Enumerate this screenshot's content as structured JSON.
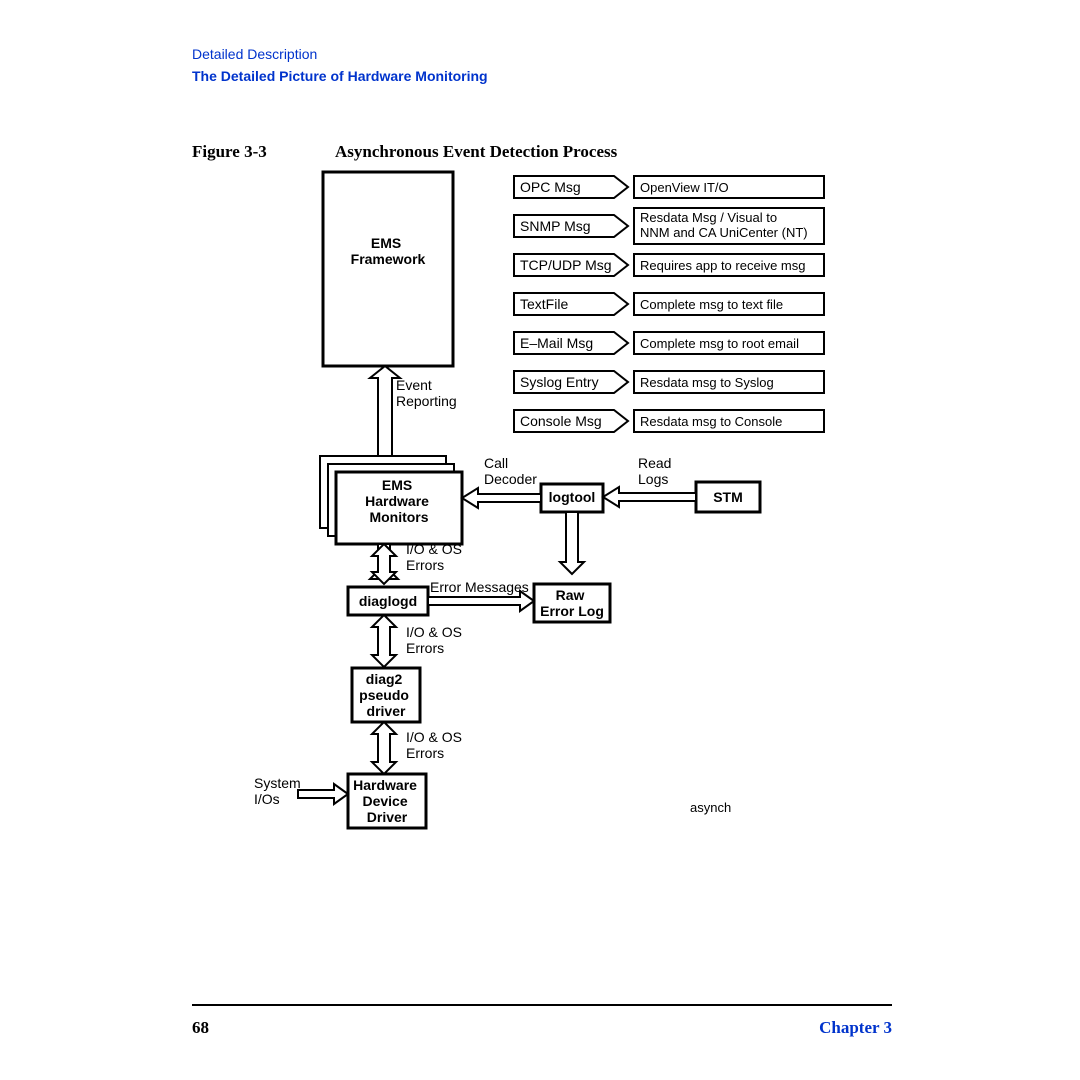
{
  "header": {
    "line1": "Detailed Description",
    "line2": "The Detailed Picture of Hardware Monitoring"
  },
  "figure": {
    "label": "Figure 3-3",
    "title": "Asynchronous Event Detection Process"
  },
  "boxes": {
    "ems_framework": "EMS\nFramework",
    "ems_monitors": "EMS\nHardware\nMonitors",
    "diaglogd": "diaglogd",
    "diag2": "diag2\npseudo\ndriver",
    "hdd": "Hardware\nDevice\nDriver",
    "logtool": "logtool",
    "raw": "Raw\nError Log",
    "stm": "STM"
  },
  "msg_rows": [
    {
      "left": "OPC Msg",
      "right": "OpenView IT/O"
    },
    {
      "left": "SNMP Msg",
      "right": "Resdata Msg / Visual to NNM and CA UniCenter (NT)"
    },
    {
      "left": "TCP/UDP Msg",
      "right": "Requires app to receive msg"
    },
    {
      "left": "TextFile",
      "right": "Complete msg to text file"
    },
    {
      "left": "E–Mail Msg",
      "right": "Complete msg to root email"
    },
    {
      "left": "Syslog Entry",
      "right": "Resdata msg to Syslog"
    },
    {
      "left": "Console Msg",
      "right": "Resdata msg to Console"
    }
  ],
  "labels": {
    "event_reporting": "Event\nReporting",
    "call_decoder": "Call\nDecoder",
    "read_logs": "Read\nLogs",
    "io_os_errors": "I/O & OS\nErrors",
    "error_messages": "Error Messages",
    "system_ios": "System\nI/Os",
    "asynch": "asynch"
  },
  "footer": {
    "page": "68",
    "chapter": "Chapter 3"
  }
}
